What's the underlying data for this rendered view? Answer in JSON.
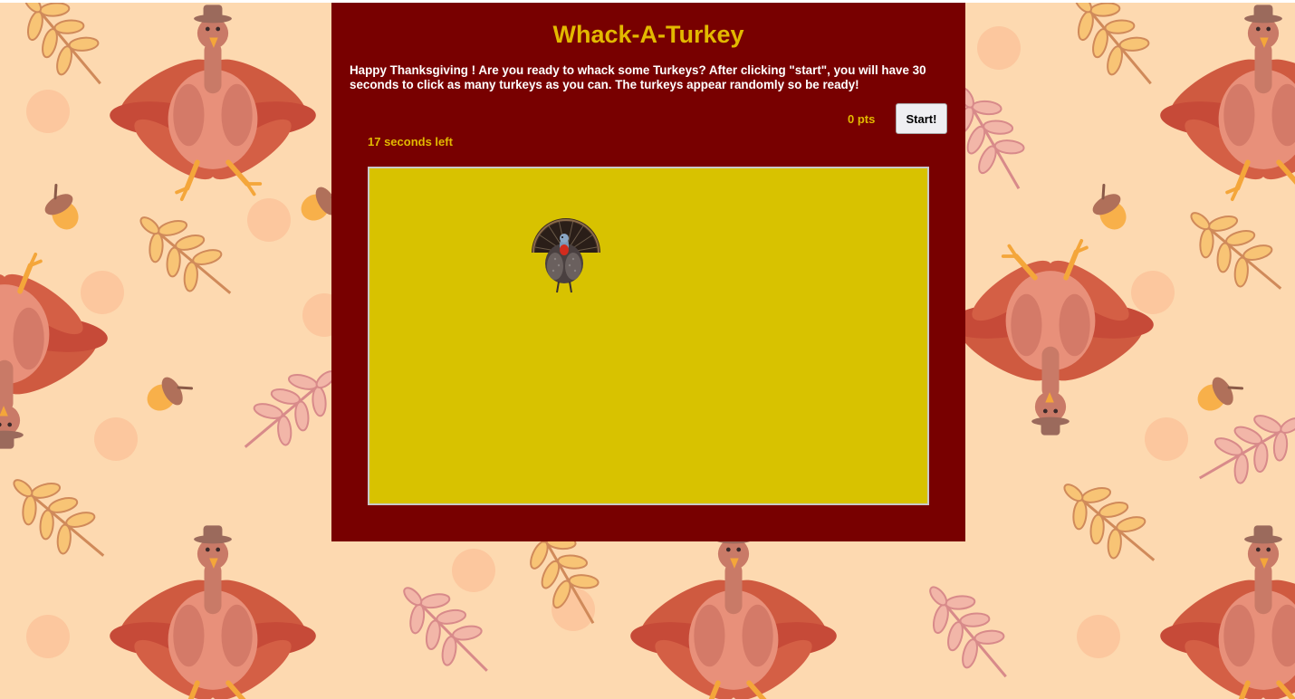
{
  "game": {
    "title": "Whack-A-Turkey",
    "intro": "Happy Thanksgiving ! Are you ready to whack some Turkeys? After clicking \"start\", you will have 30 seconds to click as many turkeys as you can. The turkeys appear randomly so be ready!",
    "score_label": "0 pts",
    "start_label": "Start!",
    "timer_label": "17 seconds left"
  },
  "colors": {
    "background": "#fdd9b0",
    "panel": "#780000",
    "accent": "#e2b900",
    "play_area": "#d8c200"
  },
  "icons": {
    "turkey": "turkey-icon"
  }
}
